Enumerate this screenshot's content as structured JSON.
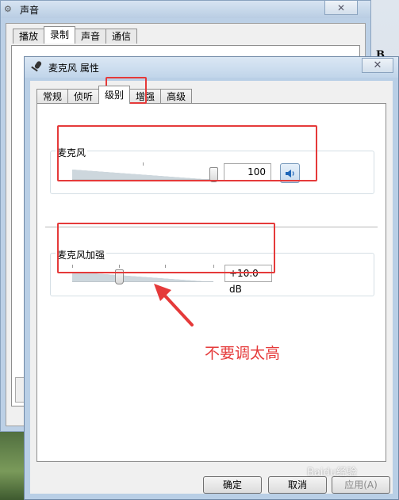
{
  "sound_window": {
    "title": "声音",
    "tabs": [
      {
        "label": "播放"
      },
      {
        "label": "录制"
      },
      {
        "label": "声音"
      },
      {
        "label": "通信"
      }
    ],
    "active_tab": "录制"
  },
  "dialog": {
    "title": "麦克风 属性",
    "close_label": "✕",
    "tabs": [
      {
        "label": "常规"
      },
      {
        "label": "侦听"
      },
      {
        "label": "级别"
      },
      {
        "label": "增强"
      },
      {
        "label": "高级"
      }
    ],
    "active_tab": "级别",
    "microphone": {
      "label": "麦克风",
      "value": "100",
      "level_fraction": 1.0
    },
    "boost": {
      "label": "麦克风加强",
      "value": "+10.0 dB",
      "level_fraction": 0.33
    },
    "buttons": {
      "ok": "确定",
      "cancel": "取消",
      "apply": "应用(A)"
    }
  },
  "annotation": {
    "text": "不要调太高",
    "color": "#e53a3a"
  },
  "background": {
    "letter": "B"
  },
  "watermark": {
    "text": "Baidu经验"
  }
}
